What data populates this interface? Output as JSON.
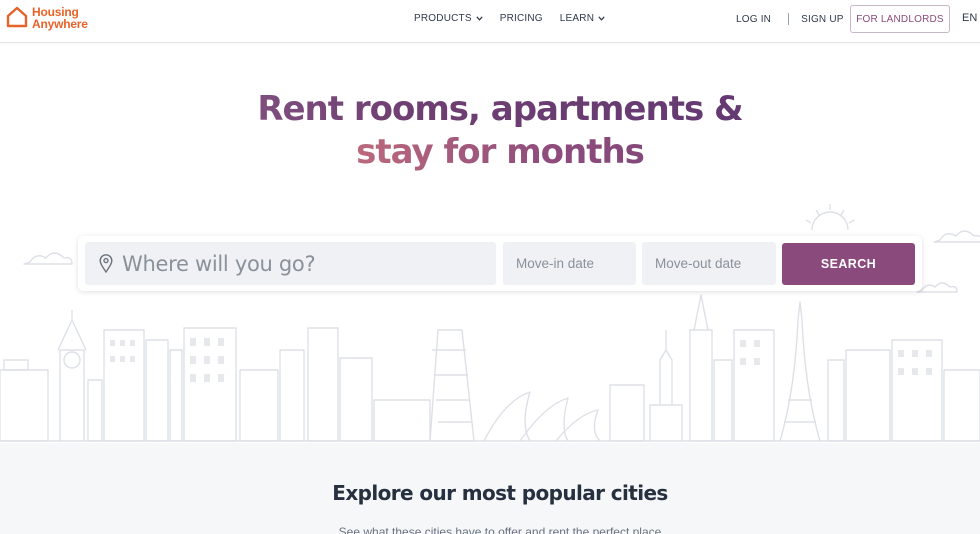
{
  "brand": {
    "line1": "Housing",
    "line2": "Anywhere",
    "color": "#e8632a"
  },
  "nav": {
    "products": "PRODUCTS",
    "pricing": "PRICING",
    "learn": "LEARN"
  },
  "account": {
    "login": "LOG IN",
    "signup": "SIGN UP",
    "landlords": "FOR LANDLORDS",
    "language": "EN"
  },
  "hero": {
    "line1": "Rent rooms, apartments &",
    "line2": "stay for months"
  },
  "search": {
    "where_placeholder": "Where will you go?",
    "movein_placeholder": "Move-in date",
    "moveout_placeholder": "Move-out date",
    "button": "SEARCH",
    "button_color": "#8b4a7c"
  },
  "explore": {
    "title": "Explore our most popular cities",
    "subtitle": "See what these cities have to offer and rent the perfect place"
  },
  "icons": [
    "house-logo-icon",
    "chevron-down-icon",
    "location-pin-icon"
  ]
}
